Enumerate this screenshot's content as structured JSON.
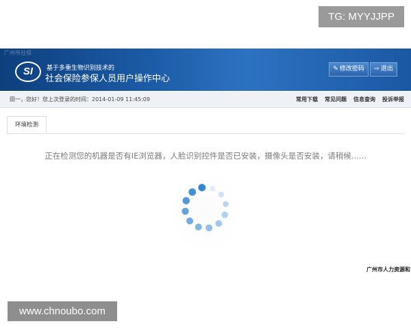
{
  "watermark": {
    "top": "TG: MYYJJPP",
    "bottom": "www.chnoubo.com"
  },
  "header": {
    "faint_text": "广州市社保",
    "logo_text": "SI",
    "subtitle": "基于多重生物识别技术的",
    "title": "社会保险参保人员用户操作中心",
    "buttons": {
      "change_password": "修改密码",
      "logout": "退出"
    }
  },
  "infobar": {
    "welcome": "田一，您好！您上次登录的时间：2014-01-09 11:45:09",
    "links": [
      "常用下载",
      "常见问题",
      "信息查询",
      "投诉举报"
    ]
  },
  "tabs": [
    {
      "label": "环境检测",
      "active": true
    }
  ],
  "main": {
    "detect_message": "正在检测您的机器是否有IE浏览器，人脸识别控件是否已安装，摄像头是否安装，请稍候......",
    "spinner_color": "#2a7fd0"
  },
  "footer": {
    "org": "广州市人力资源和"
  }
}
